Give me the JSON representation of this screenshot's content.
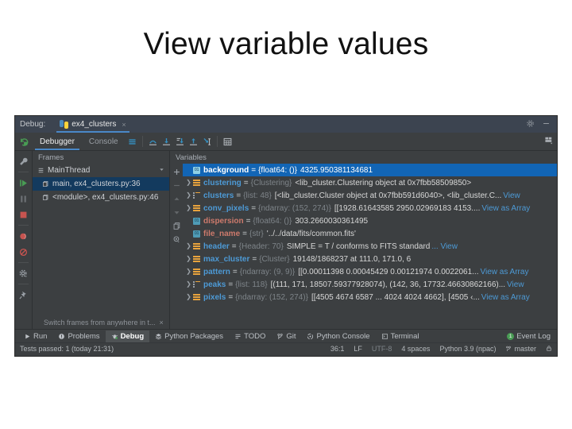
{
  "slide": {
    "title": "View variable values"
  },
  "window": {
    "titlebar": {
      "debug_label": "Debug:",
      "tab_name": "ex4_clusters",
      "tab_close": "×",
      "settings_icon": "gear-icon",
      "minimize_icon": "minimize-icon"
    },
    "toolbar": {
      "rerun_icon": "rerun-icon",
      "tabs": [
        {
          "label": "Debugger",
          "active": true
        },
        {
          "label": "Console",
          "active": false
        }
      ],
      "buttons": [
        "show-lines-icon",
        "step-over-icon",
        "step-into-icon",
        "force-step-into-icon",
        "step-out-icon",
        "run-to-cursor-icon",
        "evaluate-expression-icon"
      ],
      "layout_icon": "layout-settings-icon"
    },
    "rail": {
      "items": [
        "wrench-icon",
        "resume-program-icon",
        "pause-program-icon",
        "stop-icon",
        "view-breakpoints-icon",
        "mute-breakpoints-icon",
        "settings-gear-icon",
        "pin-icon"
      ]
    },
    "frames": {
      "header": "Frames",
      "thread": "MainThread",
      "rows": [
        {
          "label": "main, ex4_clusters.py:36",
          "selected": true
        },
        {
          "label": "<module>, ex4_clusters.py:46",
          "selected": false
        }
      ],
      "footer_hint": "Switch frames from anywhere in t...",
      "footer_close": "×"
    },
    "variables": {
      "header": "Variables",
      "gutter": [
        "add-watch-icon",
        "remove-watch-icon",
        "move-up-icon",
        "move-down-icon",
        "copy-value-icon",
        "inspect-icon"
      ],
      "rows": [
        {
          "selected": true,
          "expandable": false,
          "icon": "primitive-badge",
          "name": "background",
          "type": "{float64: ()}",
          "value": "4325.950381134681",
          "link": ""
        },
        {
          "selected": false,
          "expandable": true,
          "icon": "object-stack",
          "name": "clustering",
          "type": "{Clustering}",
          "value": "<lib_cluster.Clustering object at 0x7fbb58509850>",
          "link": ""
        },
        {
          "selected": false,
          "expandable": true,
          "icon": "list-stack",
          "name": "clusters",
          "type": "{list: 48}",
          "value": "[<lib_cluster.Cluster object at 0x7fbb591d6040>, <lib_cluster.C...",
          "link": "View"
        },
        {
          "selected": false,
          "expandable": true,
          "icon": "object-stack",
          "name": "conv_pixels",
          "type": "{ndarray: (152, 274)}",
          "value": "[[1928.61643585 2950.02969183 4153.\u0001...",
          "link": "View as Array"
        },
        {
          "selected": false,
          "expandable": false,
          "icon": "primitive-badge",
          "watch": true,
          "name": "dispersion",
          "type": "{float64: ()}",
          "value": "303.2660030361495",
          "link": ""
        },
        {
          "selected": false,
          "expandable": false,
          "icon": "primitive-badge",
          "watch": true,
          "name": "file_name",
          "type": "{str}",
          "value": "'../../data/fits/common.fits'",
          "link": ""
        },
        {
          "selected": false,
          "expandable": true,
          "icon": "object-stack",
          "name": "header",
          "type": "{Header: 70}",
          "value": "SIMPLE  =                    T / conforms to FITS standard",
          "link": "... View"
        },
        {
          "selected": false,
          "expandable": true,
          "icon": "object-stack",
          "name": "max_cluster",
          "type": "{Cluster}",
          "value": "19148/1868237 at 111.0, 171.0, 6",
          "link": ""
        },
        {
          "selected": false,
          "expandable": true,
          "icon": "object-stack",
          "name": "pattern",
          "type": "{ndarray: (9, 9)}",
          "value": "[[0.00011398 0.00045429 0.00121974 0.0022061...",
          "link": "View as Array"
        },
        {
          "selected": false,
          "expandable": true,
          "icon": "list-stack",
          "name": "peaks",
          "type": "{list: 118}",
          "value": "[(111, 171, 18507.59377928074), (142, 36, 17732.46630862166)...",
          "link": " View"
        },
        {
          "selected": false,
          "expandable": true,
          "icon": "object-stack",
          "name": "pixels",
          "type": "{ndarray: (152, 274)}",
          "value": "[[4505 4674 6587 ... 4024 4024 4662], [4505 ‹...",
          "link": "View as Array"
        }
      ]
    },
    "tool_window_bar": {
      "items": [
        {
          "label": "Run",
          "icon": "run-icon",
          "active": false
        },
        {
          "label": "Problems",
          "icon": "problems-icon",
          "active": false
        },
        {
          "label": "Debug",
          "icon": "debug-icon",
          "active": true
        },
        {
          "label": "Python Packages",
          "icon": "packages-icon",
          "active": false
        },
        {
          "label": "TODO",
          "icon": "todo-icon",
          "active": false
        },
        {
          "label": "Git",
          "icon": "git-branch-icon",
          "active": false
        },
        {
          "label": "Python Console",
          "icon": "python-console-icon",
          "active": false
        },
        {
          "label": "Terminal",
          "icon": "terminal-icon",
          "active": false
        }
      ],
      "event_log": {
        "label": "Event Log",
        "count": "1"
      }
    },
    "statusbar": {
      "message": "Tests passed: 1 (today 21:31)",
      "caret": "36:1",
      "line_sep": "LF",
      "encoding": "UTF-8",
      "indent": "4 spaces",
      "interpreter": "Python 3.9 (npac)",
      "branch": "master",
      "lock_icon": "lock-icon"
    }
  },
  "colors": {
    "accent_blue": "#4a88c7",
    "selection_blue": "#1265b5",
    "var_name_blue": "#4d9ad6",
    "watch_salmon": "#cd7a6c",
    "orange_icon": "#e8a33d",
    "panel_bg": "#3c3f41",
    "titlebar_bg": "#3c4450",
    "green_run": "#499c54",
    "red_stop": "#c75450"
  }
}
